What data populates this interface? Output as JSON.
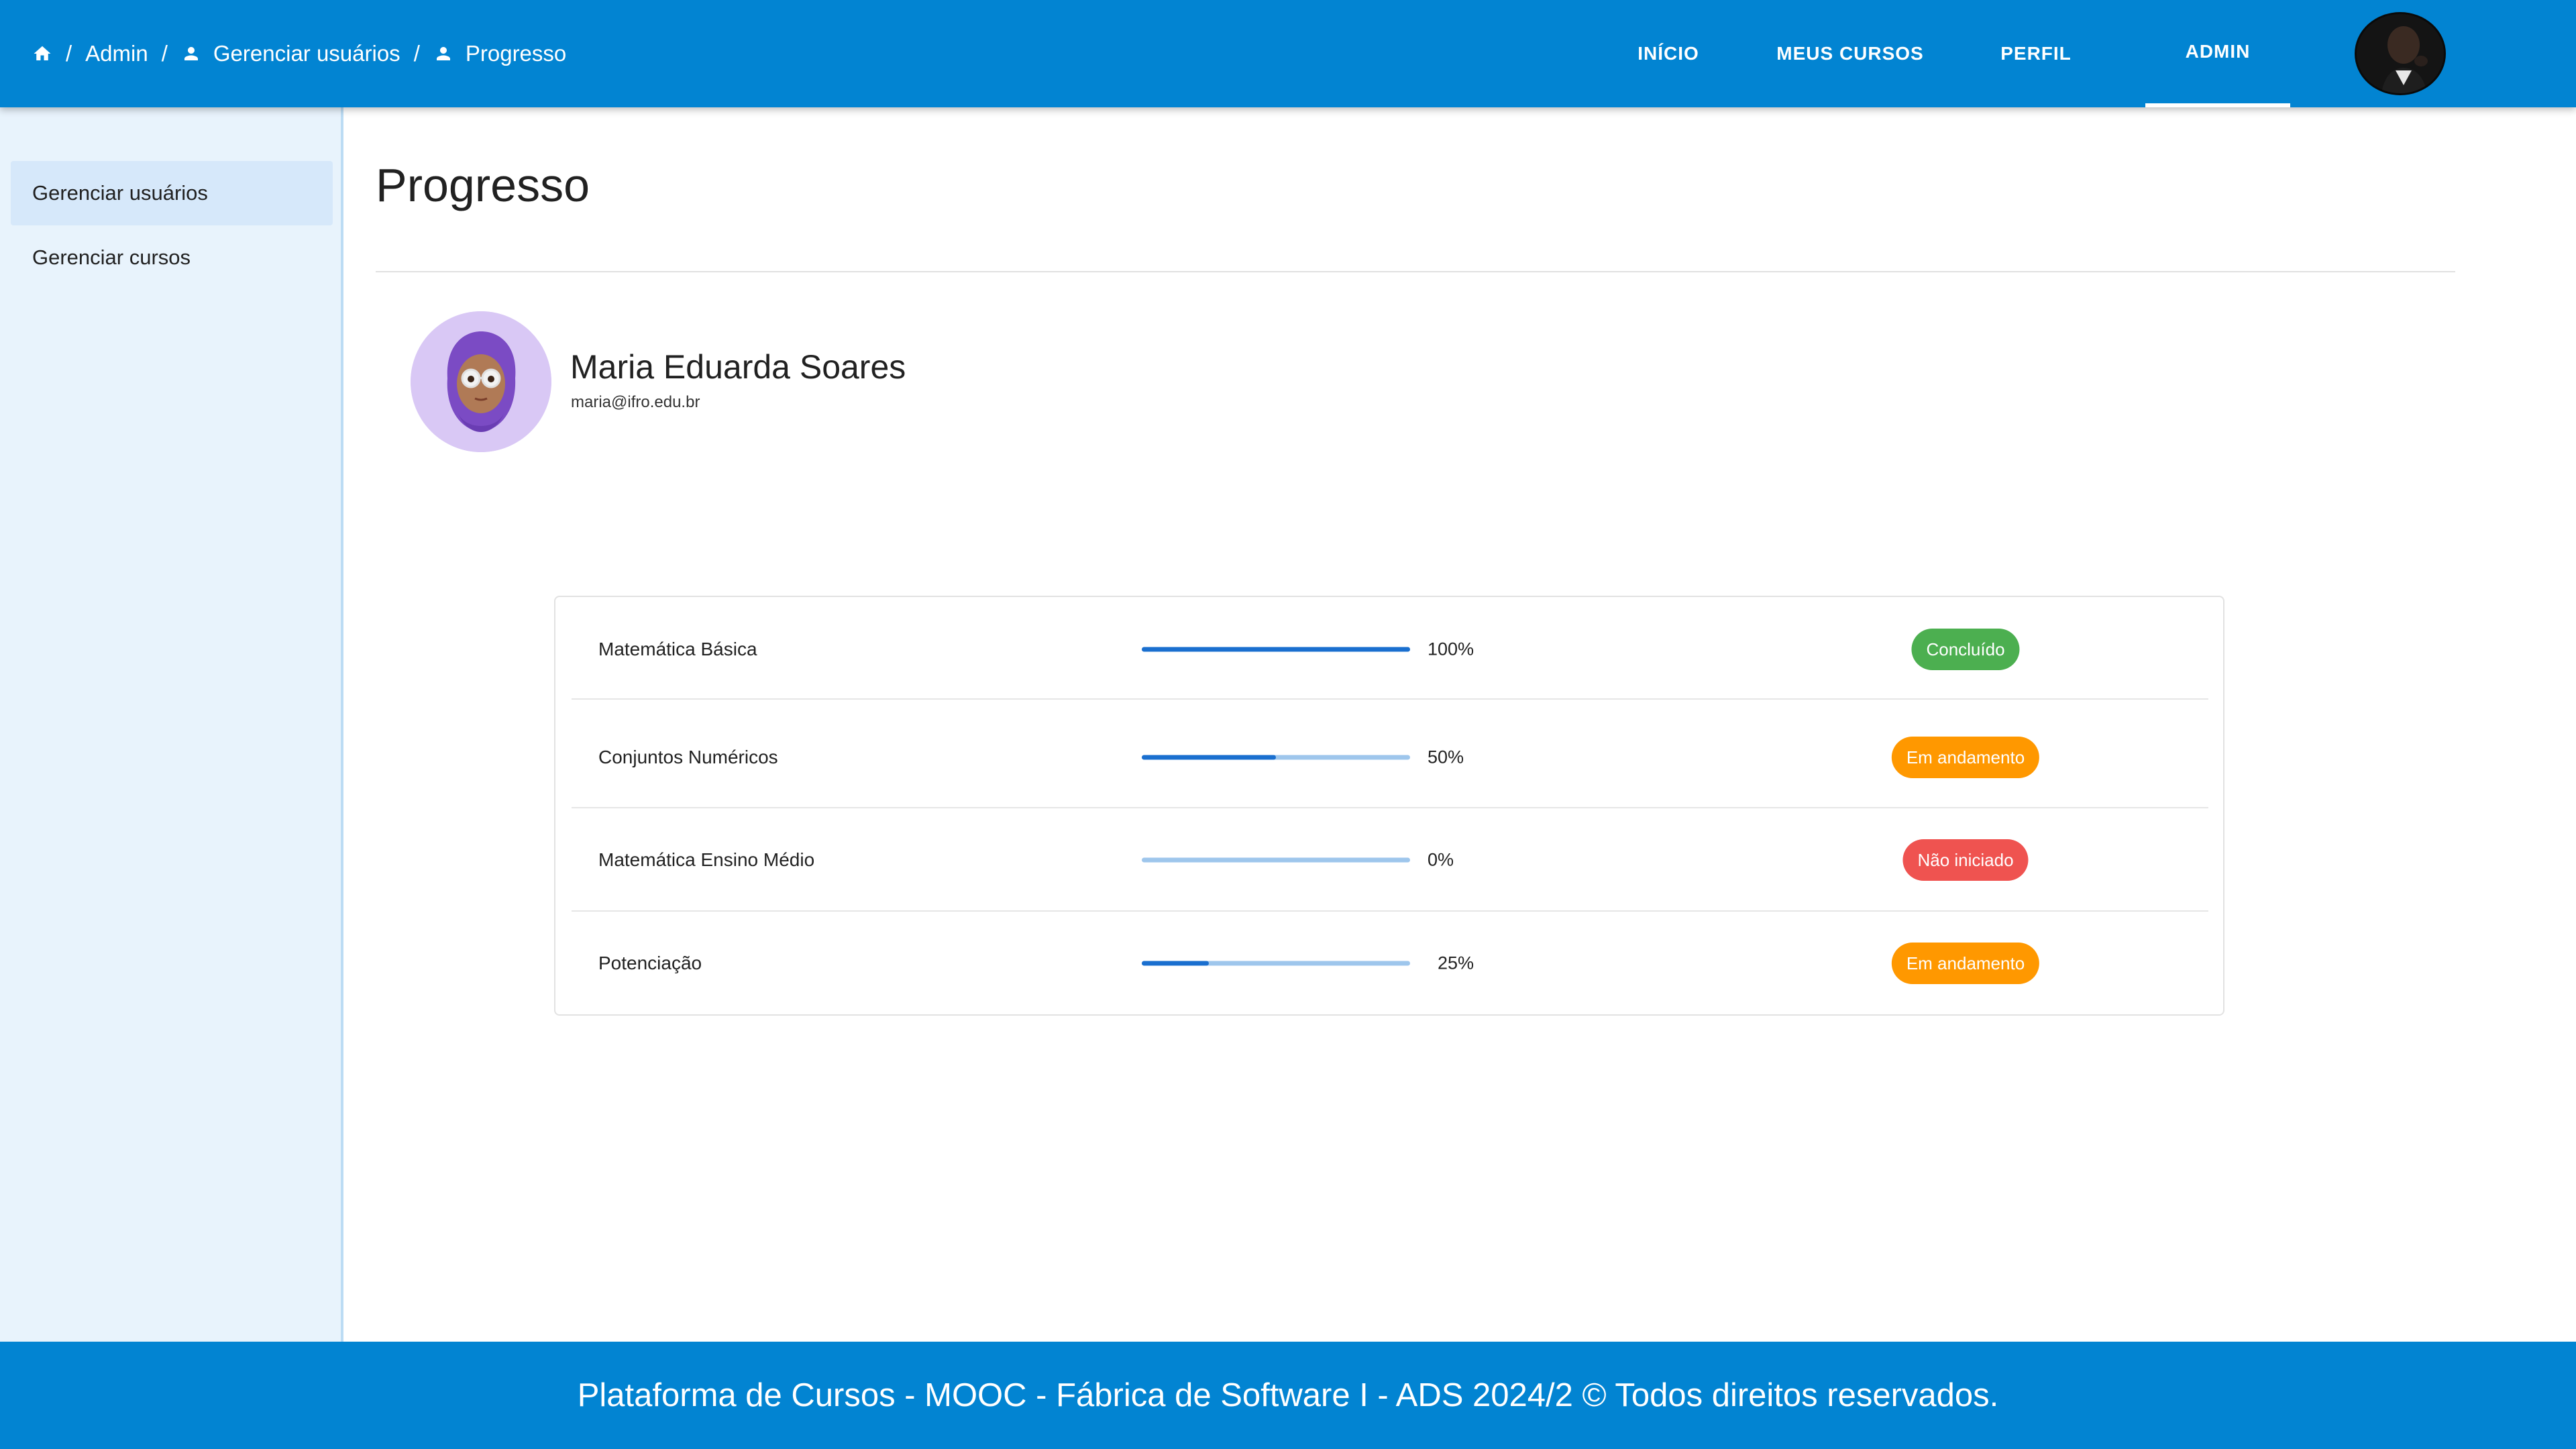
{
  "breadcrumb": {
    "items": [
      {
        "label": "",
        "icon": "home-icon"
      },
      {
        "label": "Admin"
      },
      {
        "label": "Gerenciar usuários",
        "icon": "person-icon"
      },
      {
        "label": "Progresso",
        "icon": "person-icon"
      }
    ],
    "separator": "/"
  },
  "nav": {
    "items": [
      {
        "label": "INÍCIO",
        "active": false
      },
      {
        "label": "MEUS CURSOS",
        "active": false
      },
      {
        "label": "PERFIL",
        "active": false
      },
      {
        "label": "ADMIN",
        "active": true
      }
    ]
  },
  "sidebar": {
    "items": [
      {
        "label": "Gerenciar usuários",
        "active": true
      },
      {
        "label": "Gerenciar cursos",
        "active": false
      }
    ]
  },
  "page": {
    "title": "Progresso"
  },
  "profile": {
    "name": "Maria Eduarda Soares",
    "email": "maria@ifro.edu.br",
    "avatar_icon": "memoji-avatar-icon"
  },
  "progress": {
    "rows": [
      {
        "course": "Matemática Básica",
        "percent": 100,
        "percent_label": "100%",
        "status": "Concluído",
        "status_color": "#4caf50"
      },
      {
        "course": "Conjuntos Numéricos",
        "percent": 50,
        "percent_label": "50%",
        "status": "Em andamento",
        "status_color": "#ff9800"
      },
      {
        "course": "Matemática Ensino Médio",
        "percent": 0,
        "percent_label": "0%",
        "status": "Não iniciado",
        "status_color": "#ef5350"
      },
      {
        "course": "Potenciação",
        "percent": 25,
        "percent_label": "25%",
        "status": "Em andamento",
        "status_color": "#ff9800"
      }
    ]
  },
  "footer": {
    "text": "Plataforma de Cursos - MOOC - Fábrica de Software I - ADS 2024/2  ©  Todos direitos reservados."
  },
  "colors": {
    "primary": "#0284d2",
    "sidebar_bg": "#e8f3fc",
    "progress_fill": "#1a6fcf",
    "progress_track": "#9ec6ec"
  }
}
